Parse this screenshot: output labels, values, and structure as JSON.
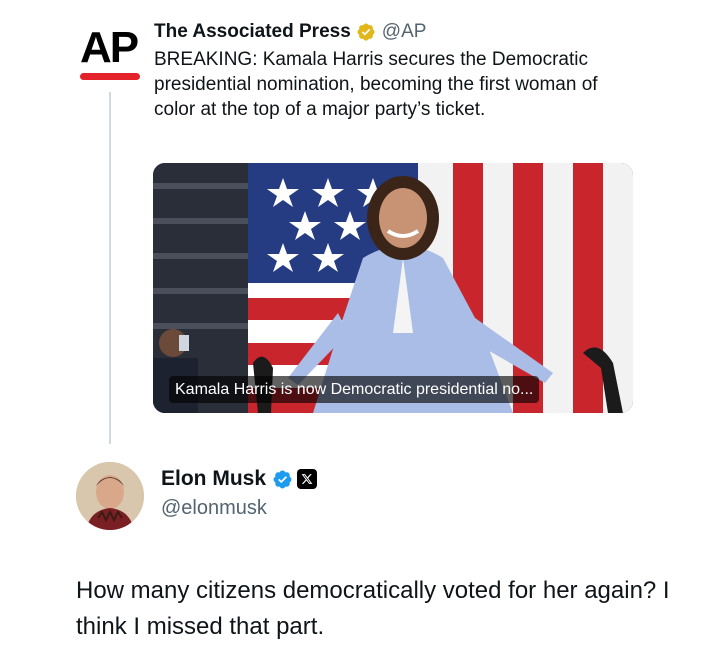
{
  "quoted_tweet": {
    "logo_text": "AP",
    "author_name": "The Associated Press",
    "author_handle": "@AP",
    "verified_badge": "gold-verified-icon",
    "text": "BREAKING: Kamala Harris secures the Democratic presidential nomination, becoming the first woman of color at the top of a major party’s ticket.",
    "media": {
      "caption": "Kamala Harris is now Democratic presidential no..."
    }
  },
  "reply_tweet": {
    "author_name": "Elon Musk",
    "author_handle": "@elonmusk",
    "verified_badge": "blue-verified-icon",
    "affiliate_badge": "x-logo-icon",
    "text": "How many citizens democratically voted for her again? I think I missed that part."
  },
  "colors": {
    "ap_red": "#e4222a",
    "gold_badge": "#e2b719",
    "blue_badge": "#1d9bf0",
    "text_primary": "#0f1419",
    "text_secondary": "#536471",
    "thread_line": "#cfd9de"
  }
}
